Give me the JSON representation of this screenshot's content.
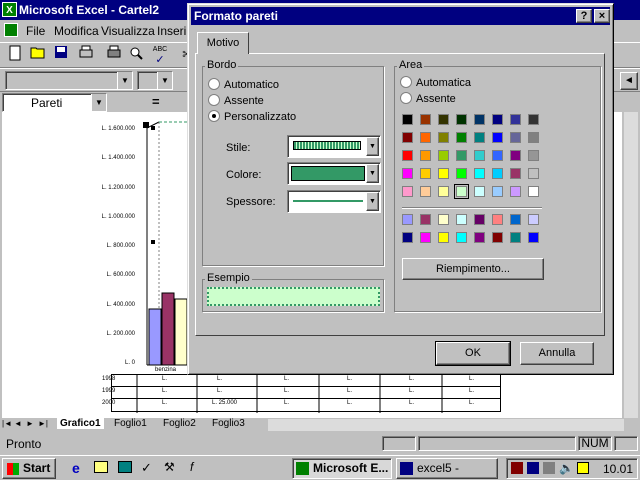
{
  "window": {
    "title": "Microsoft Excel - Cartel2"
  },
  "menu": {
    "items": [
      "File",
      "Modifica",
      "Visualizza",
      "Inseri"
    ]
  },
  "namebox": {
    "value": "Pareti",
    "equals": "="
  },
  "chart": {
    "y_ticks": [
      "L. 1.600.000",
      "L. 1.400.000",
      "L. 1.200.000",
      "L. 1.000.000",
      "L. 800.000",
      "L. 600.000",
      "L. 400.000",
      "L. 200.000",
      "L. 0"
    ],
    "category": "benzina",
    "legend": [
      "1998",
      "1999",
      "2000"
    ],
    "table_cells": {
      "row1": [
        "L.",
        "L.",
        "L.",
        "L.",
        "L.",
        "L."
      ],
      "row2": [
        "L.",
        "L.",
        "L.",
        "L.",
        "L.",
        "L."
      ],
      "row3": [
        "L.",
        "L. 25.000",
        "L.",
        "L.",
        "L.",
        "L."
      ]
    },
    "series_colors": [
      "#9999ff",
      "#993366",
      "#ffffcc"
    ]
  },
  "tabs": {
    "items": [
      "Grafico1",
      "Foglio1",
      "Foglio2",
      "Foglio3"
    ]
  },
  "status": {
    "text": "Pronto",
    "num": "NUM"
  },
  "taskbar": {
    "start": "Start",
    "task1": "Microsoft E...",
    "task2": "excel5 - Micro...",
    "clock": "10.01"
  },
  "dialog": {
    "title": "Formato pareti",
    "help": "?",
    "close": "×",
    "tab": "Motivo",
    "bordo": {
      "label": "Bordo",
      "options": [
        "Automatico",
        "Assente",
        "Personalizzato"
      ],
      "selected": 2,
      "stile_label": "Stile:",
      "colore_label": "Colore:",
      "spessore_label": "Spessore:",
      "colore_value": "#339966"
    },
    "area": {
      "label": "Area",
      "options": [
        "Automatica",
        "Assente"
      ],
      "palette_main": [
        "#000000",
        "#993300",
        "#333300",
        "#003300",
        "#003366",
        "#000080",
        "#333399",
        "#333333",
        "#800000",
        "#ff6600",
        "#808000",
        "#008000",
        "#008080",
        "#0000ff",
        "#666699",
        "#808080",
        "#ff0000",
        "#ff9900",
        "#99cc00",
        "#339966",
        "#33cccc",
        "#3366ff",
        "#800080",
        "#969696",
        "#ff00ff",
        "#ffcc00",
        "#ffff00",
        "#00ff00",
        "#00ffff",
        "#00ccff",
        "#993366",
        "#c0c0c0",
        "#ff99cc",
        "#ffcc99",
        "#ffff99",
        "#ccffcc",
        "#ccffff",
        "#99ccff",
        "#cc99ff",
        "#ffffff"
      ],
      "palette_chart": [
        "#9999ff",
        "#993366",
        "#ffffcc",
        "#ccffff",
        "#660066",
        "#ff8080",
        "#0066cc",
        "#ccccff",
        "#000080",
        "#ff00ff",
        "#ffff00",
        "#00ffff",
        "#800080",
        "#800000",
        "#008080",
        "#0000ff"
      ],
      "fill_button": "Riempimento..."
    },
    "esempio": {
      "label": "Esempio",
      "color": "#ccffcc"
    },
    "ok": "OK",
    "cancel": "Annulla"
  }
}
